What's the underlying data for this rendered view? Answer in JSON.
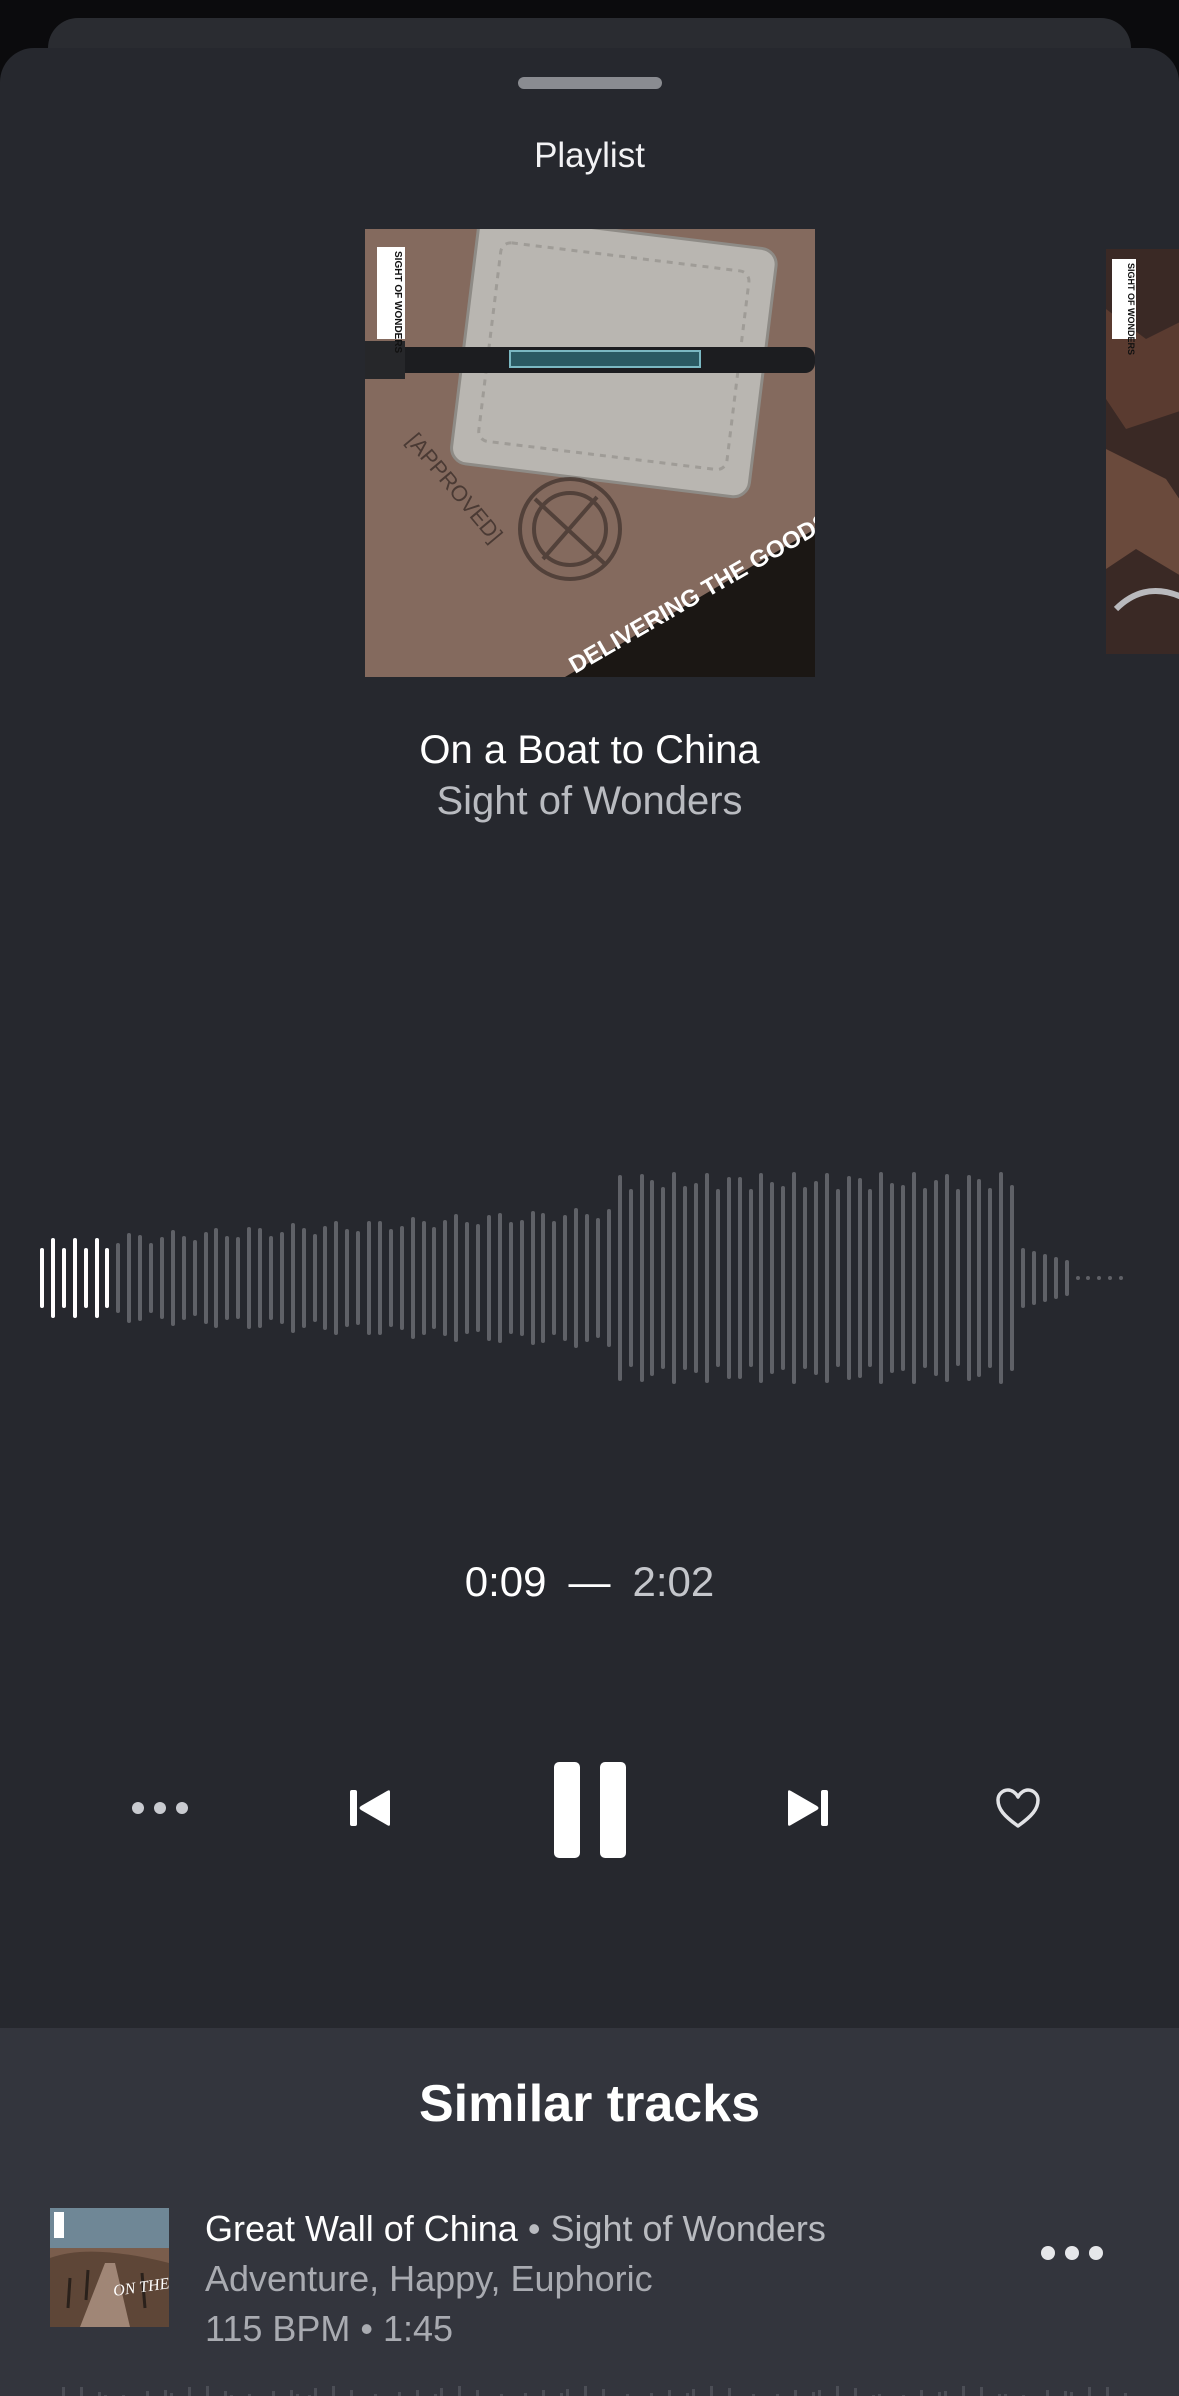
{
  "sheet": {
    "title": "Playlist"
  },
  "now_playing": {
    "title": "On a Boat to China",
    "artist": "Sight of Wonders",
    "cover_text": {
      "label_vertical": "SIGHT OF WONDERS",
      "stamp": "[APPROVED]",
      "tagline": "DELIVERING THE GOODS"
    },
    "next_cover_label": "SIGHT OF WONDERS",
    "progress_fraction": 0.074
  },
  "time": {
    "current": "0:09",
    "separator": "—",
    "total": "2:02"
  },
  "controls": {
    "more": "more-icon",
    "previous": "skip-previous-icon",
    "play_pause": "pause-icon",
    "next": "skip-next-icon",
    "favorite": "heart-icon"
  },
  "similar": {
    "title": "Similar tracks",
    "items": [
      {
        "title": "Great Wall of China",
        "separator": "•",
        "artist": "Sight of Wonders",
        "tags": "Adventure, Happy, Euphoric",
        "meta": "115 BPM • 1:45",
        "cover_text": "ON THE TRAIL"
      }
    ]
  },
  "colors": {
    "background": "#26282e",
    "similar_background": "#33353d",
    "waveform_played": "#ffffff",
    "waveform_unplayed": "#5f6167"
  }
}
